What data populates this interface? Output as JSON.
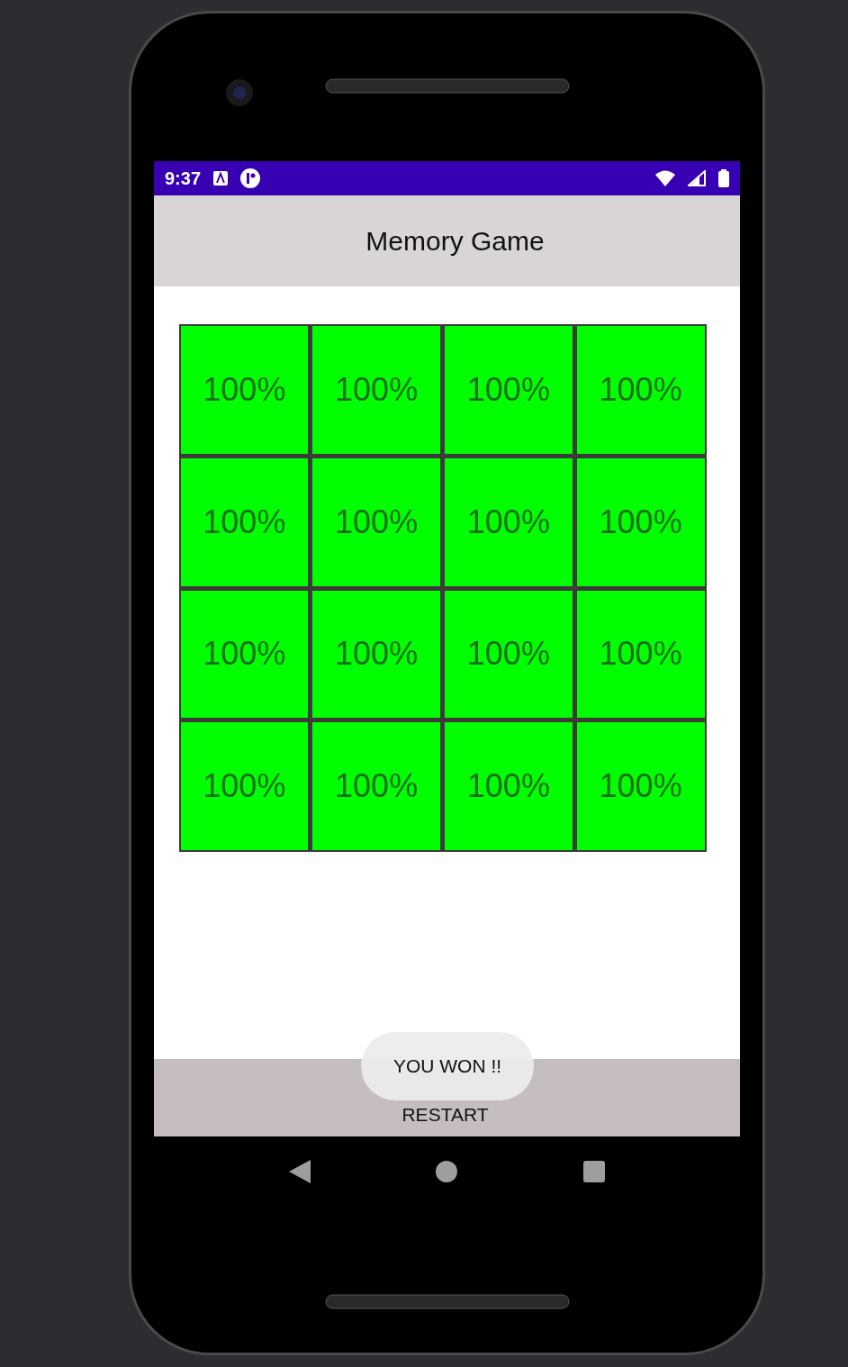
{
  "status_bar": {
    "time": "9:37"
  },
  "app_bar": {
    "title": "Memory Game"
  },
  "cards": [
    {
      "label": "100%",
      "matched": true
    },
    {
      "label": "100%",
      "matched": true
    },
    {
      "label": "100%",
      "matched": true
    },
    {
      "label": "100%",
      "matched": true
    },
    {
      "label": "100%",
      "matched": true
    },
    {
      "label": "100%",
      "matched": true
    },
    {
      "label": "100%",
      "matched": true
    },
    {
      "label": "100%",
      "matched": true
    },
    {
      "label": "100%",
      "matched": true
    },
    {
      "label": "100%",
      "matched": true
    },
    {
      "label": "100%",
      "matched": true
    },
    {
      "label": "100%",
      "matched": true
    },
    {
      "label": "100%",
      "matched": true
    },
    {
      "label": "100%",
      "matched": true
    },
    {
      "label": "100%",
      "matched": true
    },
    {
      "label": "100%",
      "matched": true
    }
  ],
  "restart_button": {
    "label": "RESTART"
  },
  "toast": {
    "text": "YOU WON !!"
  }
}
